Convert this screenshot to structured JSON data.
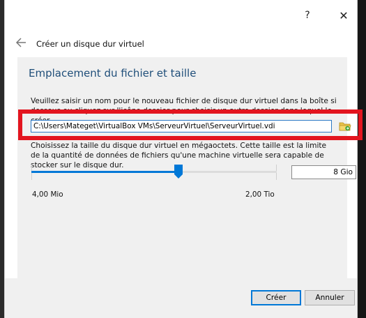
{
  "titlebar": {
    "help_glyph": "?",
    "close_glyph": "✕"
  },
  "wizard": {
    "title": "Créer un disque dur virtuel",
    "section_title": "Emplacement du fichier et taille",
    "location_description": "Veuillez saisir un nom pour le nouveau fichier de disque dur virtuel dans la boîte si dessous ou cliquez sur l'icône dossier pour choisir un autre dossier dans lequel le créer.",
    "file_path": "C:\\Users\\Mateget\\VirtualBox VMs\\ServeurVirtuel\\ServeurVirtuel.vdi",
    "size_description": "Choisissez la taille du disque dur virtuel en mégaoctets. Cette taille est la limite de la quantité de données de fichiers qu'une machine virtuelle sera capable de stocker sur le disque dur.",
    "size_value": "8 Gio",
    "slider_min_label": "4,00 Mio",
    "slider_max_label": "2,00 Tio",
    "slider_fraction": 0.6
  },
  "buttons": {
    "create": "Créer",
    "cancel": "Annuler"
  },
  "colors": {
    "accent": "#0078d7",
    "highlight": "#e3151f",
    "section_title": "#1f4e79"
  },
  "icons": {
    "back": "back-arrow-icon",
    "folder": "folder-icon",
    "help": "help-icon",
    "close": "close-icon"
  }
}
